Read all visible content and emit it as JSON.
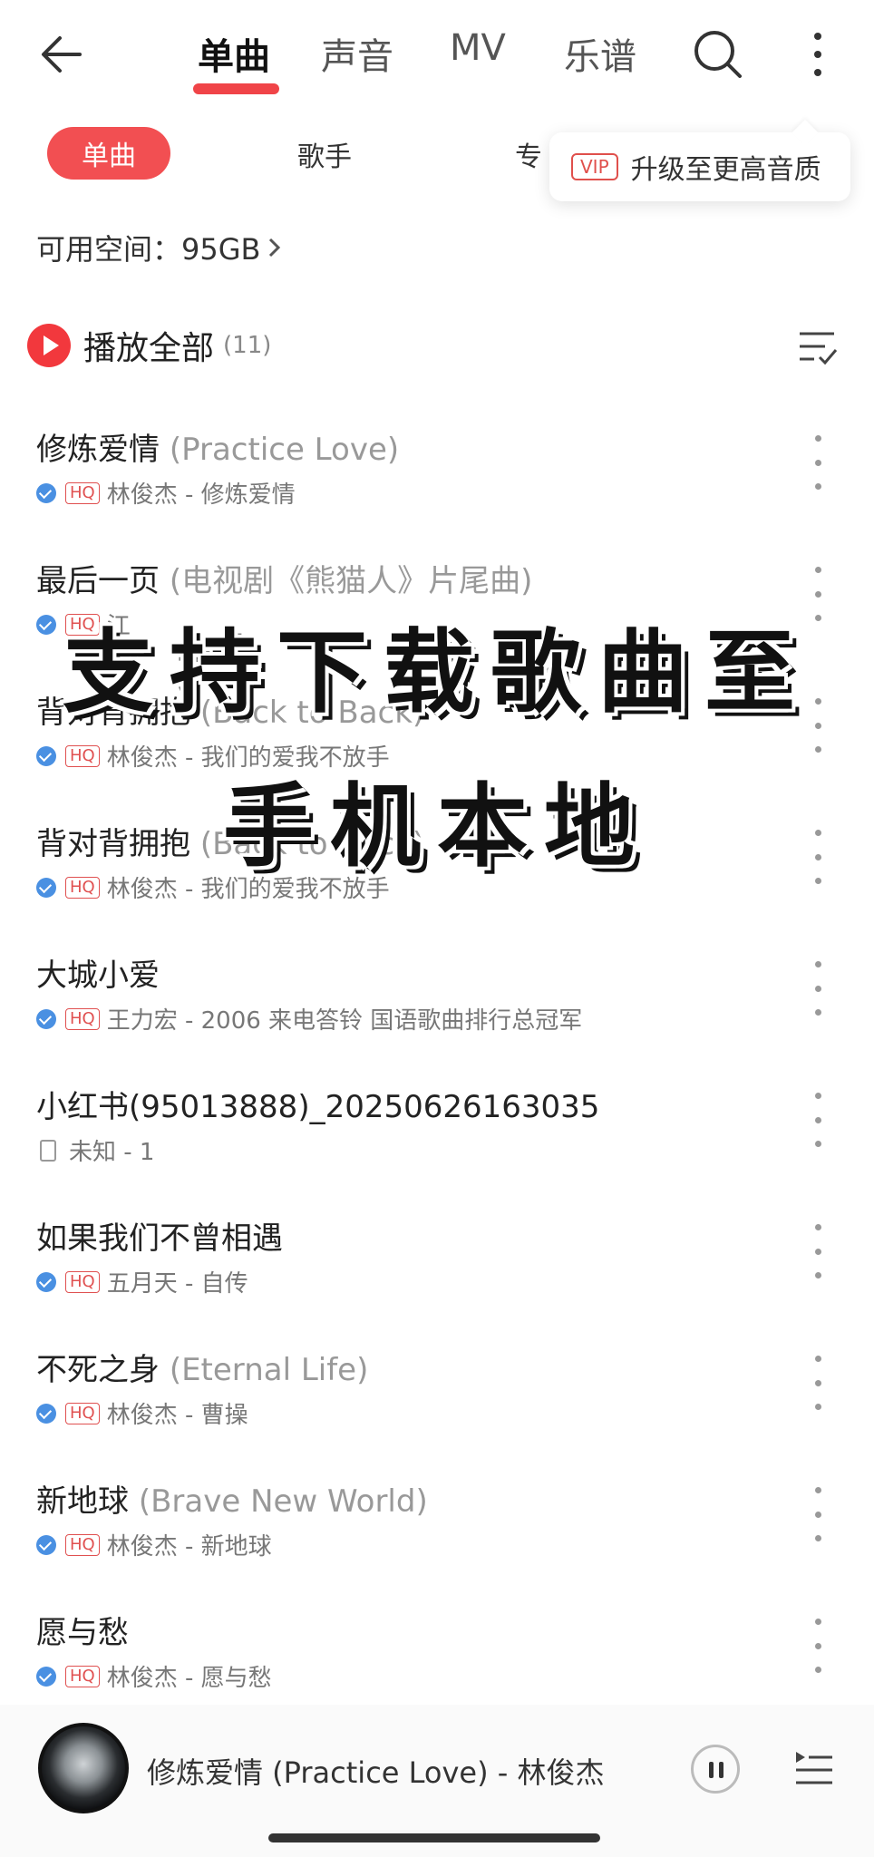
{
  "topbar": {
    "tabs": [
      {
        "label": "单曲",
        "active": true
      },
      {
        "label": "声音",
        "active": false
      },
      {
        "label": "MV",
        "active": false
      },
      {
        "label": "乐谱",
        "active": false
      }
    ],
    "accent_color": "#f04448"
  },
  "subtabs": {
    "active_label": "单曲",
    "items": [
      "歌手",
      "专"
    ]
  },
  "vip_popup": {
    "badge": "VIP",
    "text": "升级至更高音质"
  },
  "storage": {
    "label": "可用空间：95GB"
  },
  "play_all": {
    "label": "播放全部",
    "count": "(11)"
  },
  "songs": [
    {
      "title": "修炼爱情",
      "alias": "(Practice Love)",
      "quality": "HQ",
      "subtitle": "林俊杰 - 修炼爱情",
      "verified": true
    },
    {
      "title": "最后一页",
      "alias": "(电视剧《熊猫人》片尾曲)",
      "quality": "HQ",
      "subtitle": "江",
      "verified": true
    },
    {
      "title": "背对背拥抱",
      "alias": "(Back to Back)",
      "quality": "HQ",
      "subtitle": "林俊杰 - 我们的爱我不放手",
      "verified": true
    },
    {
      "title": "背对背拥抱",
      "alias": "(Back to Back)",
      "quality": "HQ",
      "subtitle": "林俊杰 - 我们的爱我不放手",
      "verified": true
    },
    {
      "title": "大城小爱",
      "alias": "",
      "quality": "HQ",
      "subtitle": "王力宏 - 2006 来电答铃 国语歌曲排行总冠军",
      "verified": true
    },
    {
      "title": "小红书(95013888)_20250626163035",
      "alias": "",
      "quality": "",
      "subtitle": "未知 - 1",
      "verified": false
    },
    {
      "title": "如果我们不曾相遇",
      "alias": "",
      "quality": "HQ",
      "subtitle": "五月天 - 自传",
      "verified": true
    },
    {
      "title": "不死之身",
      "alias": "(Eternal Life)",
      "quality": "HQ",
      "subtitle": "林俊杰 - 曹操",
      "verified": true
    },
    {
      "title": "新地球",
      "alias": "(Brave New World)",
      "quality": "HQ",
      "subtitle": "林俊杰 - 新地球",
      "verified": true
    },
    {
      "title": "愿与愁",
      "alias": "",
      "quality": "HQ",
      "subtitle": "林俊杰 - 愿与愁",
      "verified": true
    }
  ],
  "overlay": {
    "line1": "支持下载歌曲至",
    "line2": "手机本地"
  },
  "player": {
    "now_playing": "修炼爱情 (Practice Love) - 林俊杰",
    "state": "playing"
  }
}
